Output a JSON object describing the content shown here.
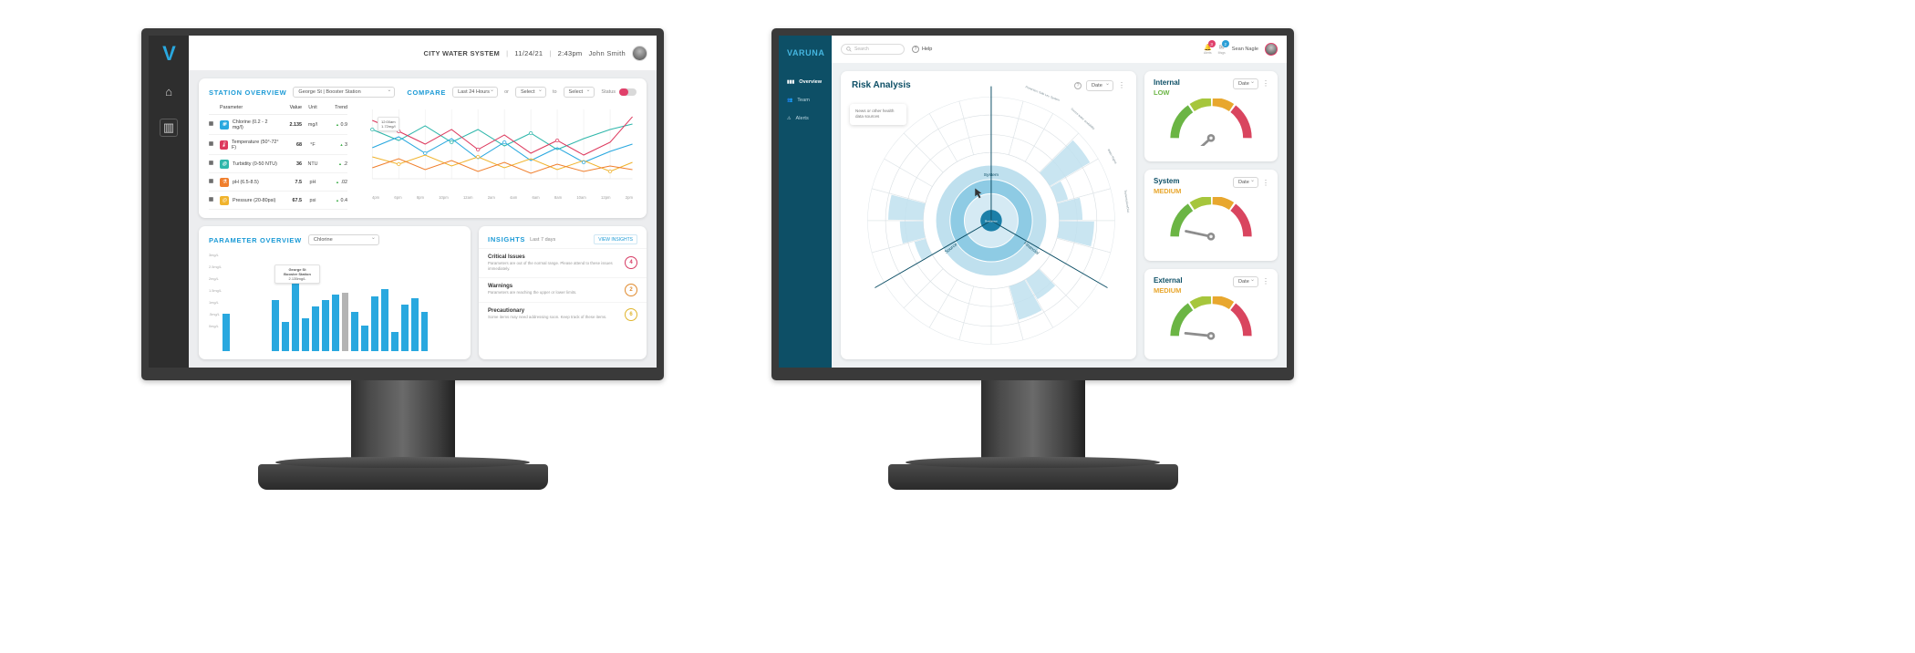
{
  "left_app": {
    "rail": {
      "logo": "V",
      "items": [
        {
          "name": "home-icon",
          "glyph": "⌂"
        },
        {
          "name": "analytics-icon",
          "glyph": "▥"
        }
      ]
    },
    "header": {
      "system": "CITY WATER SYSTEM",
      "date": "11/24/21",
      "time": "2:43pm",
      "user": "John Smith",
      "sep": "|"
    },
    "station_overview": {
      "title": "STATION OVERVIEW",
      "station_select": "George St | Booster Station",
      "compare_title": "COMPARE",
      "range_select": "Last 24 Hours",
      "or_label": "or",
      "select_a": "Select",
      "to_label": "to",
      "select_b": "Select",
      "status_label": "Status",
      "columns": [
        "Parameter",
        "Value",
        "Unit",
        "Trend"
      ],
      "rows": [
        {
          "param": "Chlorine (0.2 - 2 mg/l)",
          "value": "2.135",
          "unit": "mg/l",
          "trend": "0.9",
          "dir": "up",
          "color": "#29a8df",
          "icon": "✾"
        },
        {
          "param": "Temperature (50°-72° F)",
          "value": "68",
          "unit": "°F",
          "trend": "3",
          "dir": "up",
          "color": "#dd3a5e",
          "icon": "🌡"
        },
        {
          "param": "Turbidity (0-50 NTU)",
          "value": "36",
          "unit": "NTU",
          "trend": ".2",
          "dir": "up",
          "color": "#2fb7ab",
          "icon": "◍"
        },
        {
          "param": "pH (6.5-8.5)",
          "value": "7.5",
          "unit": "pH",
          "trend": ".02",
          "dir": "up",
          "color": "#f07f2d",
          "icon": "⚗"
        },
        {
          "param": "Pressure (20-80psi)",
          "value": "67.5",
          "unit": "psi",
          "trend": "0.4",
          "dir": "up",
          "color": "#f0b32d",
          "icon": "◎"
        }
      ],
      "chart_tooltip": [
        "12:00am",
        "1.72mg/l"
      ],
      "x_ticks": [
        "4pm",
        "6pm",
        "8pm",
        "10pm",
        "12am",
        "2am",
        "4am",
        "6am",
        "8am",
        "10am",
        "12pm",
        "2pm"
      ]
    },
    "parameter_overview": {
      "title": "PARAMETER OVERVIEW",
      "select": "Chlorine",
      "y_ticks": [
        "3mg/L",
        "2.5mg/L",
        "2mg/L",
        "1.5mg/L",
        "1mg/L",
        ".5mg/L",
        "0mg/L"
      ],
      "tooltip": [
        "George St",
        "Booster Station",
        "2.135mg/L"
      ]
    },
    "insights": {
      "title": "INSIGHTS",
      "range": "Last 7 days",
      "action": "VIEW INSIGHTS",
      "items": [
        {
          "title": "Critical Issues",
          "desc": "Parameters are out of the normal range. Please attend to these issues immediately.",
          "count": "4",
          "color": "#d63a63"
        },
        {
          "title": "Warnings",
          "desc": "Parameters are reaching the upper or lower limits.",
          "count": "2",
          "color": "#e08a2d"
        },
        {
          "title": "Precautionary",
          "desc": "Some items may need addressing soon. Keep track of these items.",
          "count": "6",
          "color": "#e0b52d"
        }
      ]
    }
  },
  "right_app": {
    "logo": "VARUNA",
    "logo_accent": "V",
    "nav": [
      {
        "label": "Overview",
        "icon": "bar-chart-icon",
        "active": true
      },
      {
        "label": "Team",
        "icon": "people-icon",
        "active": false
      },
      {
        "label": "Alerts",
        "icon": "warning-icon",
        "active": false
      }
    ],
    "topbar": {
      "search_placeholder": "Search",
      "help": "Help",
      "alert_count": "3",
      "message_count": "2",
      "alert_label": "Alerts",
      "message_label": "Msgs",
      "user": "Sean Nagle"
    },
    "risk": {
      "title": "Risk Analysis",
      "date_select": "Date",
      "tooltip": "News or other health data sources",
      "center_label": "Resilience",
      "ring_labels_top": [
        "Protection: Safe Lev. System",
        "Source water availability",
        "Water Rights",
        "Transmission/Dist."
      ],
      "ring_labels_inner": [
        "System",
        "Source",
        "Financial"
      ]
    },
    "gauges": [
      {
        "name": "Internal",
        "value": "LOW",
        "value_color": "#6bb544",
        "date_select": "Date",
        "angle": -42
      },
      {
        "name": "System",
        "value": "MEDIUM",
        "value_color": "#e8a72e",
        "date_select": "Date",
        "angle": 12
      },
      {
        "name": "External",
        "value": "MEDIUM",
        "value_color": "#e8a72e",
        "date_select": "Date",
        "angle": 6
      }
    ]
  },
  "colors": {
    "brand_blue": "#1b9ad6",
    "deep_teal": "#0d4f66",
    "accent_pink": "#e0406a",
    "green": "#6bb544",
    "amber": "#e8a72e",
    "red": "#d9455f"
  }
}
